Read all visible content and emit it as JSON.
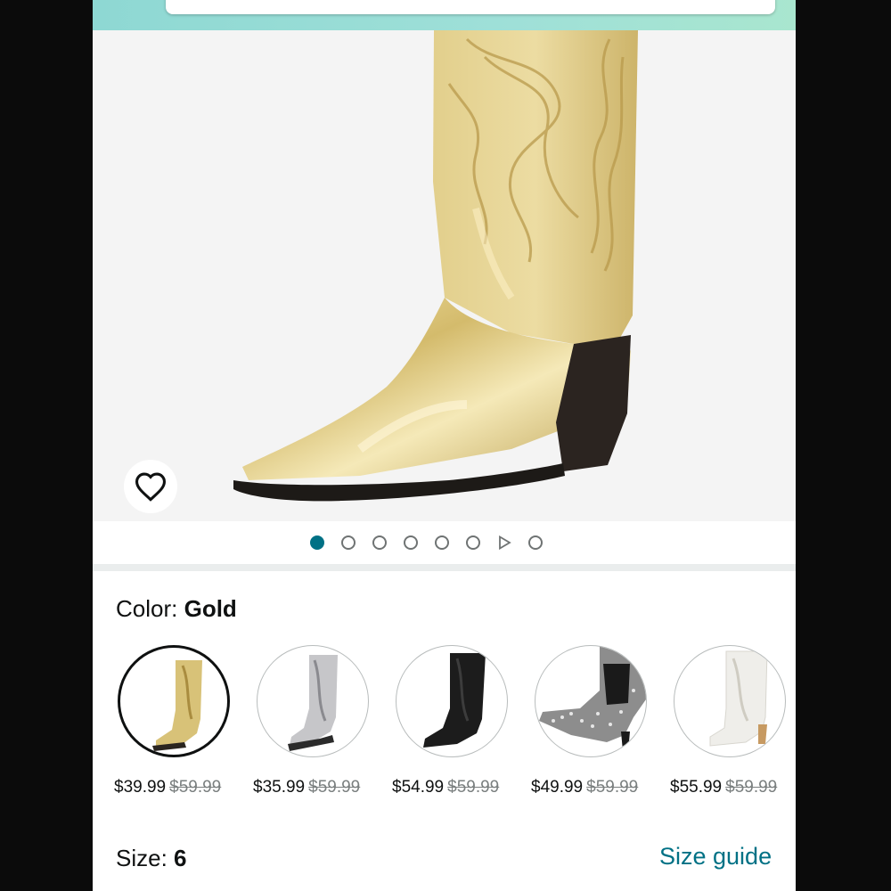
{
  "product": {
    "image_alt": "Gold metallic western boot"
  },
  "carousel": {
    "total_dots": 8,
    "active_index": 0,
    "video_index": 6
  },
  "variant": {
    "color_label": "Color:",
    "color_value": "Gold",
    "swatches": [
      {
        "name": "Gold",
        "price": "$39.99",
        "list_price": "$59.99",
        "selected": true,
        "tone": "#d8c278"
      },
      {
        "name": "Silver",
        "price": "$35.99",
        "list_price": "$59.99",
        "selected": false,
        "tone": "#c6c6c9"
      },
      {
        "name": "Black",
        "price": "$54.99",
        "list_price": "$59.99",
        "selected": false,
        "tone": "#1c1c1c"
      },
      {
        "name": "Rhinestone",
        "price": "$49.99",
        "list_price": "$59.99",
        "selected": false,
        "tone": "#8d8d8d"
      },
      {
        "name": "White",
        "price": "$55.99",
        "list_price": "$59.99",
        "selected": false,
        "tone": "#efeeea"
      }
    ]
  },
  "size": {
    "label": "Size:",
    "value": "6",
    "guide_link": "Size guide"
  },
  "colors": {
    "accent": "#007185",
    "header_gradient_start": "#8ed8d3",
    "header_gradient_end": "#a9e6cf"
  },
  "icons": {
    "wishlist": "heart-outline-icon",
    "video": "play-triangle-icon"
  }
}
